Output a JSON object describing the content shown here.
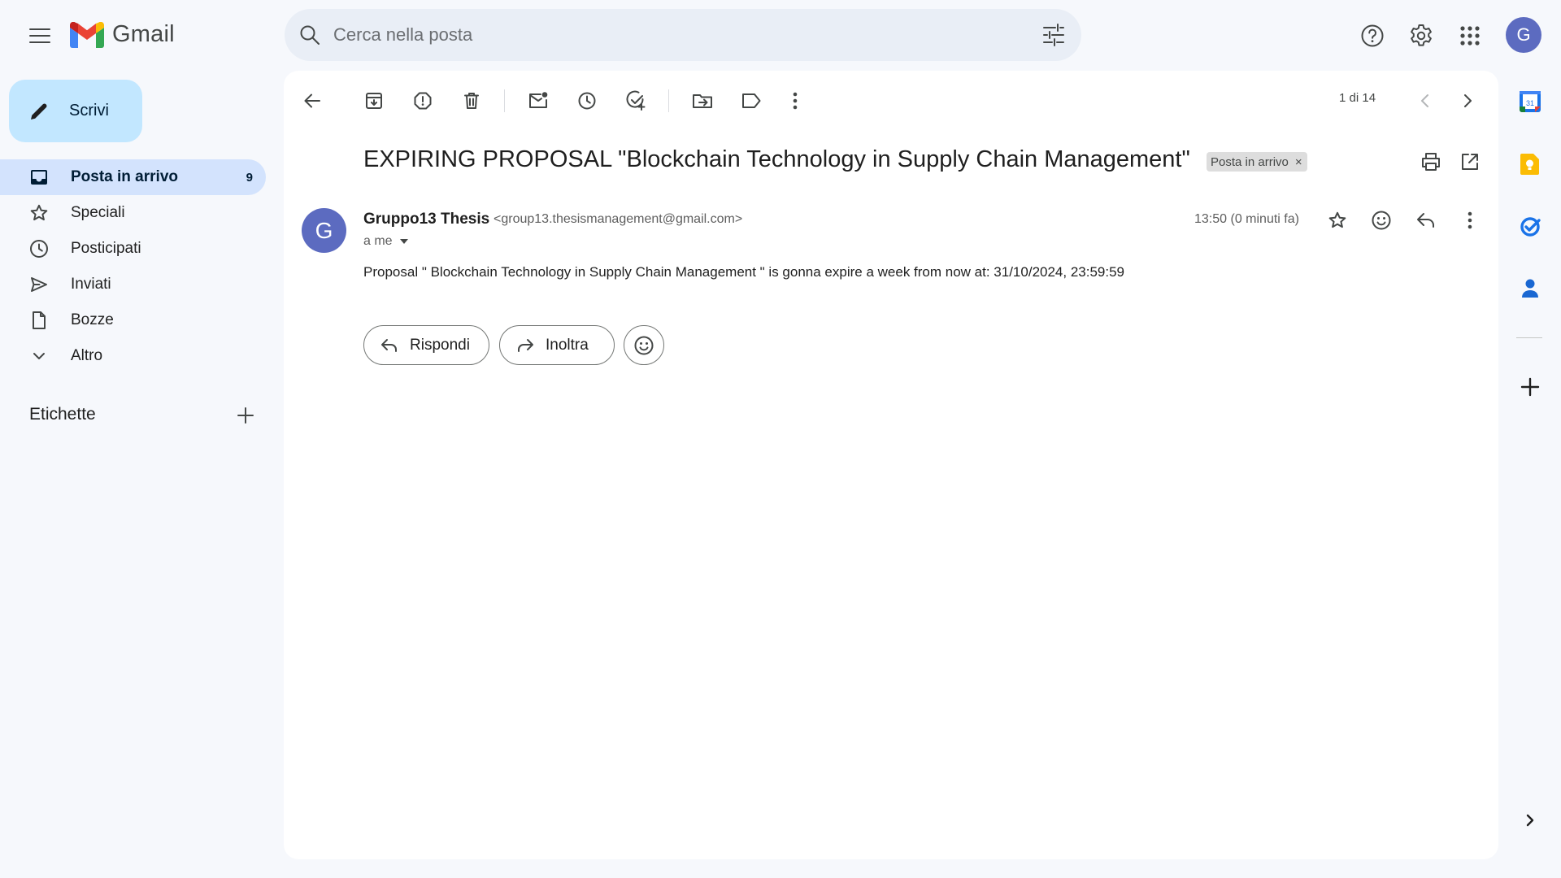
{
  "app": {
    "brand": "Gmail",
    "colors": {
      "accent": "#0b57d0",
      "compose_bg": "#c2e7ff",
      "active_nav_bg": "#d3e3fd",
      "avatar": "#5c6bc0"
    }
  },
  "header": {
    "search_placeholder": "Cerca nella posta",
    "avatar_letter": "G",
    "icons": [
      "menu-icon",
      "search-icon",
      "search-options-icon",
      "help-icon",
      "settings-icon",
      "apps-icon"
    ]
  },
  "sidebar": {
    "compose_label": "Scrivi",
    "items": [
      {
        "label": "Posta in arrivo",
        "count": "9",
        "icon": "inbox-icon",
        "active": true
      },
      {
        "label": "Speciali",
        "icon": "star-icon"
      },
      {
        "label": "Posticipati",
        "icon": "clock-icon"
      },
      {
        "label": "Inviati",
        "icon": "send-icon"
      },
      {
        "label": "Bozze",
        "icon": "draft-icon"
      },
      {
        "label": "Altro",
        "icon": "chevron-down-icon"
      }
    ],
    "labels_title": "Etichette"
  },
  "toolbar": {
    "pager": "1 di 14",
    "actions": [
      "back",
      "archive",
      "report-spam",
      "delete",
      "mark-unread",
      "snooze",
      "add-task",
      "move-to",
      "labels",
      "more"
    ]
  },
  "email": {
    "subject": "EXPIRING PROPOSAL \"Blockchain Technology in Supply Chain Management\"",
    "label_chip": "Posta in arrivo",
    "sender_name": "Gruppo13 Thesis",
    "sender_email": "<group13.thesismanagement@gmail.com>",
    "sender_initial": "G",
    "recipient": "a me",
    "time": "13:50 (0 minuti fa)",
    "body": "Proposal \" Blockchain Technology in Supply Chain Management \" is gonna expire a week from now at: 31/10/2024, 23:59:59",
    "reply_label": "Rispondi",
    "forward_label": "Inoltra"
  },
  "right_rail": {
    "calendar_day": "31",
    "apps": [
      "calendar-icon",
      "keep-icon",
      "tasks-icon",
      "contacts-icon",
      "add-addon-icon",
      "expand-panel-icon"
    ]
  }
}
